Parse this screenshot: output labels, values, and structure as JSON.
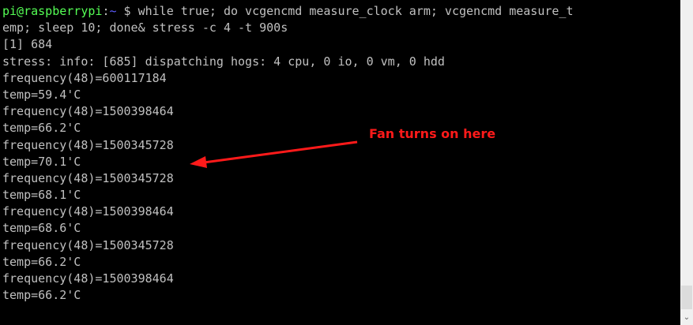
{
  "terminal": {
    "prompt": {
      "user_host": "pi@raspberrypi",
      "colon": ":",
      "path": "~",
      "symbol": " $ "
    },
    "command_line1": "while true; do vcgencmd measure_clock arm; vcgencmd measure_t",
    "lines": [
      "emp; sleep 10; done& stress -c 4 -t 900s",
      "[1] 684",
      "stress: info: [685] dispatching hogs: 4 cpu, 0 io, 0 vm, 0 hdd",
      "frequency(48)=600117184",
      "temp=59.4'C",
      "frequency(48)=1500398464",
      "temp=66.2'C",
      "frequency(48)=1500345728",
      "temp=70.1'C",
      "frequency(48)=1500345728",
      "temp=68.1'C",
      "frequency(48)=1500398464",
      "temp=68.6'C",
      "frequency(48)=1500345728",
      "temp=66.2'C",
      "frequency(48)=1500398464",
      "temp=66.2'C"
    ]
  },
  "annotation": {
    "text": "Fan turns on here",
    "color": "#ff1a1a"
  },
  "scrollbar": {
    "down_arrow": "⌄"
  }
}
